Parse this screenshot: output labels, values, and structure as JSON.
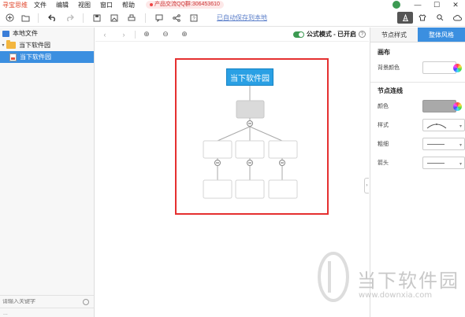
{
  "app": {
    "name": "寻宝思维"
  },
  "menu": {
    "items": [
      "文件",
      "编辑",
      "视图",
      "窗口",
      "帮助"
    ]
  },
  "promo": {
    "text": "产品交流QQ群:306453610"
  },
  "window_controls": {
    "minimize": "—",
    "maximize": "☐",
    "close": "✕"
  },
  "toolbar": {
    "saved_text": "已自动保存到本地",
    "icons": [
      "new-icon",
      "open-folder-icon",
      "undo-icon",
      "redo-icon",
      "save-icon",
      "image-icon",
      "print-icon",
      "comment-icon",
      "share-icon",
      "help-icon"
    ]
  },
  "toolbar_right": {
    "icons": [
      "style-icon",
      "shirt-icon",
      "search-icon",
      "cloud-icon"
    ]
  },
  "left_panel": {
    "root_label": "本地文件",
    "folder_label": "当下软件园",
    "file_label": "当下软件园",
    "search_placeholder": "请输入关键字",
    "bottom_text": "..."
  },
  "canvas_toolbar": {
    "back": "‹",
    "forward": "›",
    "zoom_in": "⊕",
    "zoom_out": "⊖",
    "zoom_fit": "⊕",
    "formula_label": "公式模式 - 已开启",
    "help": "?"
  },
  "mindmap": {
    "root_text": "当下软件园"
  },
  "right_panel": {
    "tabs": [
      "节点样式",
      "整体风格"
    ],
    "active_tab": "整体风格",
    "canvas_section": "画布",
    "bg_color_label": "背景颜色",
    "line_section": "节点连线",
    "color_label": "颜色",
    "style_label": "样式",
    "thickness_label": "粗细",
    "arrow_label": "箭头"
  },
  "watermark": {
    "text": "当下软件园",
    "url": "www.downxia.com"
  },
  "colors": {
    "accent": "#3b8fe0",
    "root_node": "#2aa0e4",
    "highlight": "#e53030",
    "toggle": "#3c9a52",
    "line_color": "#a9a9a9"
  }
}
